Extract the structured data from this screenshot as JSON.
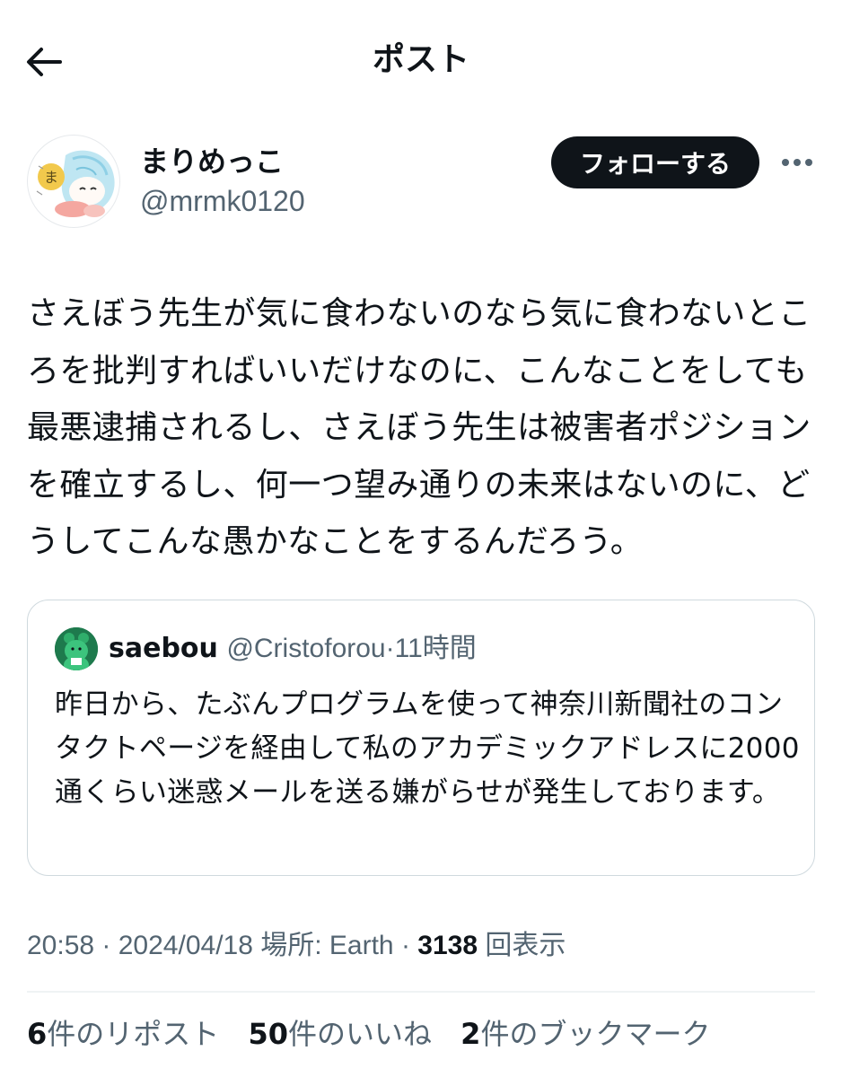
{
  "header": {
    "title": "ポスト",
    "back_icon": "arrow-left-icon"
  },
  "author": {
    "name": "まりめっこ",
    "handle": "@mrmk0120",
    "follow_label": "フォローする",
    "more_icon": "more-horizontal-icon"
  },
  "post": {
    "text": "さえぼう先生が気に食わないのなら気に食わないところを批判すればいいだけなのに、こんなことをしても最悪逮捕されるし、さえぼう先生は被害者ポジションを確立するし、何一つ望み通りの未来はないのに、どうしてこんな愚かなことをするんだろう。"
  },
  "quote": {
    "name": "saebou",
    "handle": "@Cristoforou",
    "separator": "·",
    "time": "11時間",
    "text": "昨日から、たぶんプログラムを使って神奈川新聞社のコンタクトページを経由して私のアカデミックアドレスに2000通くらい迷惑メールを送る嫌がらせが発生しております。"
  },
  "meta": {
    "time": "20:58",
    "sep1": " · ",
    "date": "2024/04/18",
    "location": " 場所: Earth",
    "sep2": " · ",
    "views_count": "3138",
    "views_label": " 回表示"
  },
  "stats": [
    {
      "count": "6",
      "label": "件のリポスト"
    },
    {
      "count": "50",
      "label": "件のいいね"
    },
    {
      "count": "2",
      "label": "件のブックマーク"
    }
  ],
  "colors": {
    "text": "#0f1419",
    "secondary": "#536471",
    "border": "#cfd9de",
    "button_bg": "#0f1419"
  }
}
